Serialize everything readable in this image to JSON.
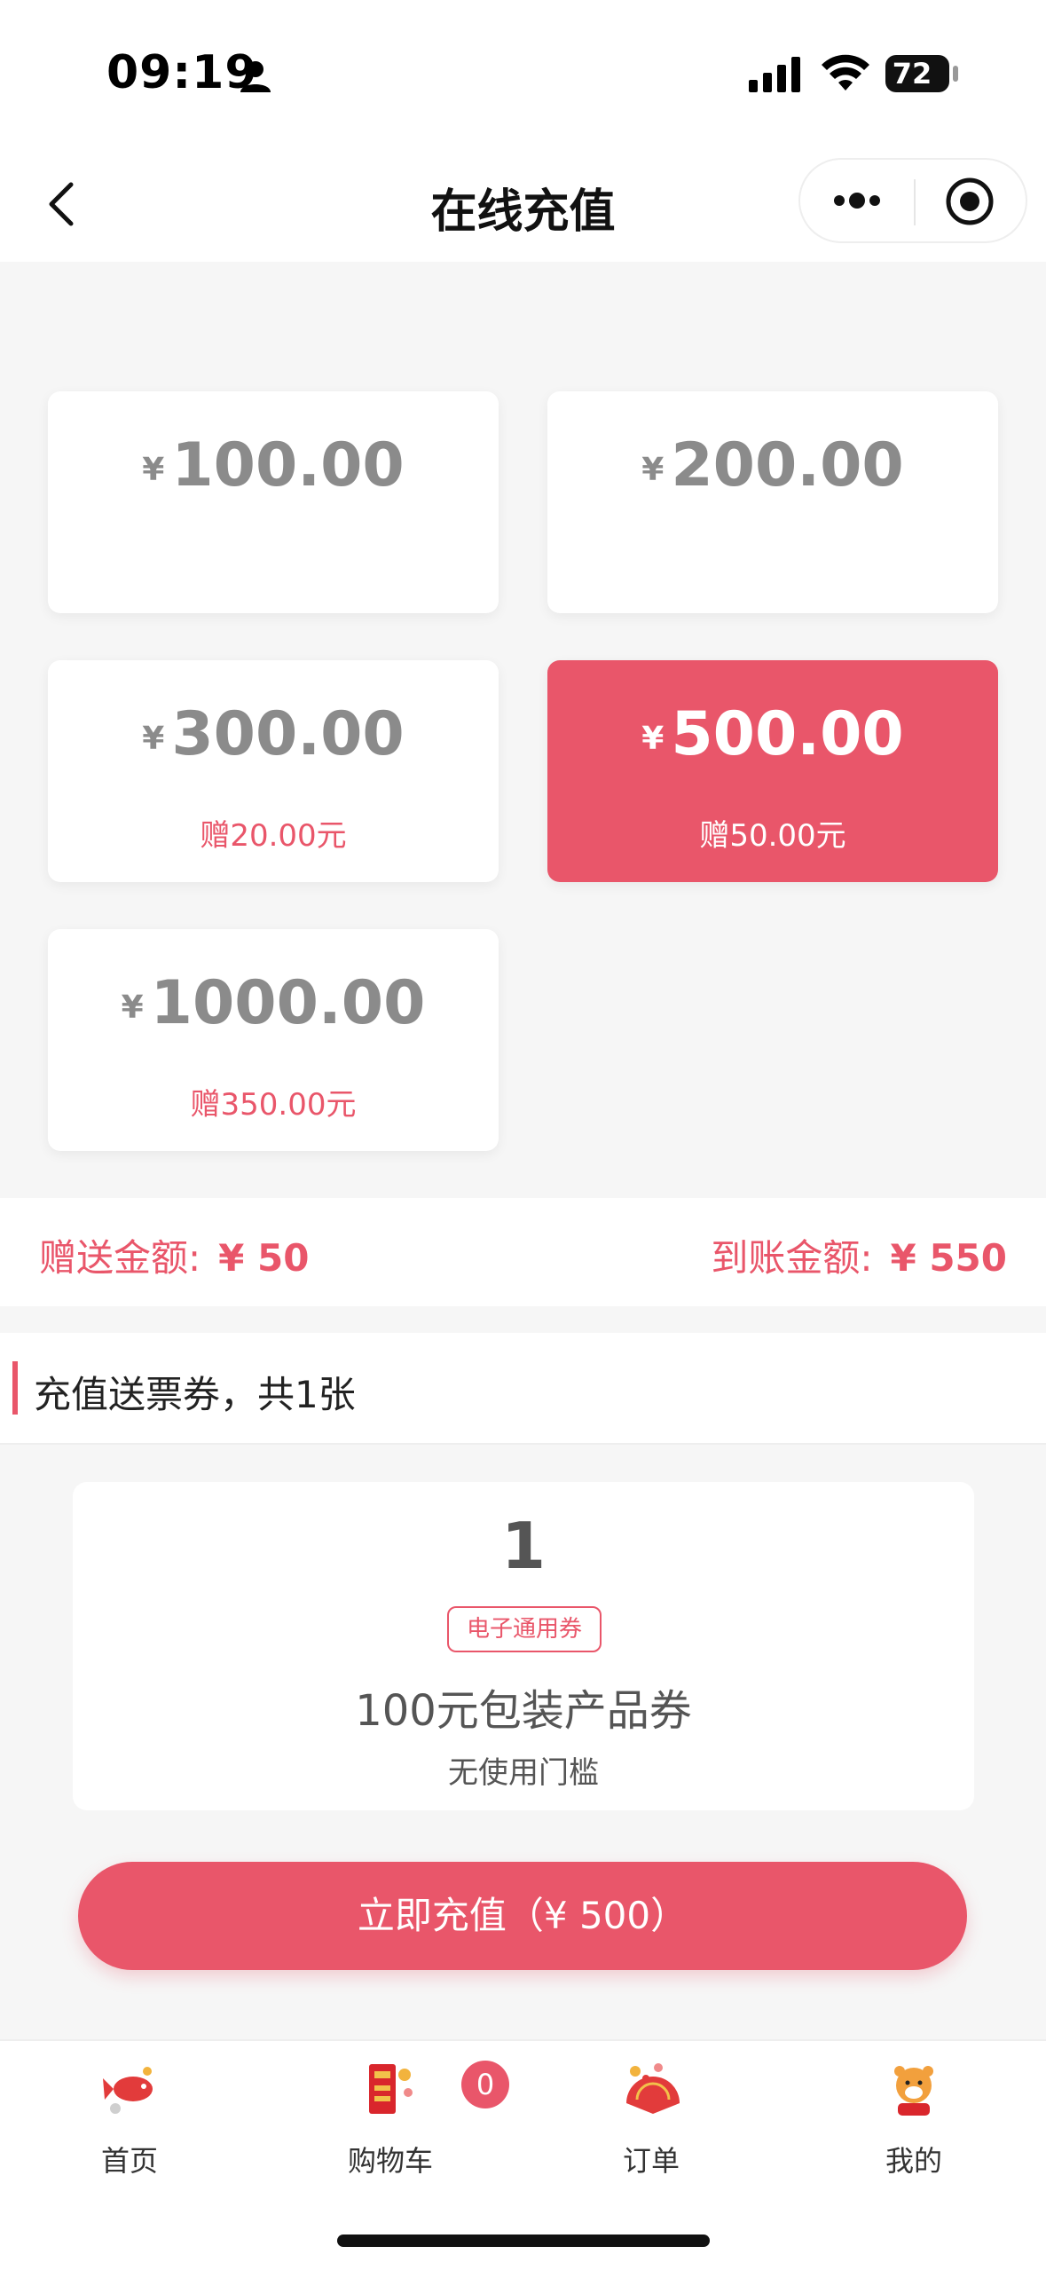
{
  "status_bar": {
    "time": "09:19",
    "battery": "72"
  },
  "nav": {
    "title": "在线充值"
  },
  "amounts": [
    {
      "currency": "¥",
      "value": "100.00",
      "bonus": "",
      "selected": false
    },
    {
      "currency": "¥",
      "value": "200.00",
      "bonus": "",
      "selected": false
    },
    {
      "currency": "¥",
      "value": "300.00",
      "bonus": "赠20.00元",
      "selected": false
    },
    {
      "currency": "¥",
      "value": "500.00",
      "bonus": "赠50.00元",
      "selected": true
    },
    {
      "currency": "¥",
      "value": "1000.00",
      "bonus": "赠350.00元",
      "selected": false
    }
  ],
  "summary": {
    "bonus_label": "赠送金额:",
    "bonus_value": "¥ 50",
    "arrive_label": "到账金额:",
    "arrive_value": "¥ 550"
  },
  "coupon_section": {
    "title": "充值送票券，共1张",
    "coupon": {
      "count": "1",
      "tag": "电子通用券",
      "name": "100元包装产品券",
      "desc": "无使用门槛"
    }
  },
  "recharge_button": {
    "label": "立即充值（¥ 500）"
  },
  "tabbar": {
    "items": [
      {
        "label": "首页",
        "icon": "home-fish-icon"
      },
      {
        "label": "购物车",
        "icon": "cart-envelope-icon"
      },
      {
        "label": "订单",
        "icon": "order-fan-icon"
      },
      {
        "label": "我的",
        "icon": "mine-tiger-icon"
      }
    ],
    "cart_badge": "0"
  },
  "colors": {
    "accent": "#e9566a",
    "muted": "#8b8b8b",
    "background": "#f6f6f6"
  }
}
